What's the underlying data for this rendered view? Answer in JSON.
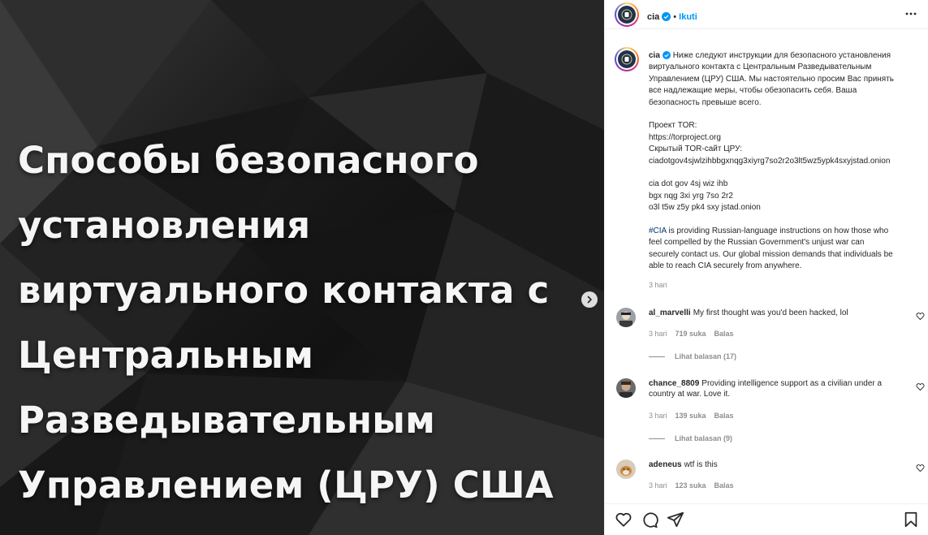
{
  "media": {
    "title_lines": [
      "Способы безопасного",
      "установления",
      "виртуального контакта с",
      "Центральным",
      "Разведывательным",
      "Управлением (ЦРУ) США"
    ]
  },
  "header": {
    "username": "cia",
    "separator": "•",
    "follow_label": "Ikuti"
  },
  "caption": {
    "username": "cia",
    "lines": [
      "Ниже следуют инструкции для безопасного установления",
      "виртуального контакта с Центральным Разведывательным",
      "Управлением (ЦРУ) США. Мы настоятельно просим Вас принять",
      "все надлежащие меры, чтобы обезопасить себя. Ваша",
      "безопасность превыше всего.",
      "",
      "Проект TOR:",
      "https://torproject.org",
      "Скрытый TOR-сайт ЦРУ:",
      "ciadotgov4sjwlzihbbgxnqg3xiyrg7so2r2o3lt5wz5ypk4sxyjstad.onion",
      "",
      "cia dot gov 4sj wiz ihb",
      "bgx nqg 3xi yrg 7so 2r2",
      "o3l t5w z5y pk4 sxy jstad.onion",
      ""
    ],
    "hashtag": "#CIA",
    "english_first": " is providing Russian-language instructions on how those who",
    "english_lines": [
      "feel compelled by the Russian Government's unjust war can",
      "securely contact us. Our global mission demands that individuals be",
      "able to reach CIA securely from anywhere."
    ],
    "time": "3 hari"
  },
  "comments": [
    {
      "username": "al_marvelli",
      "text": "My first thought was you'd been hacked, lol",
      "time": "3 hari",
      "likes": "719 suka",
      "reply": "Balas",
      "view_replies": "Lihat balasan (17)"
    },
    {
      "username": "chance_8809",
      "text": "Providing intelligence support as a civilian under a country at war. Love it.",
      "time": "3 hari",
      "likes": "139 suka",
      "reply": "Balas",
      "view_replies": "Lihat balasan (9)"
    },
    {
      "username": "adeneus",
      "text": "wtf is this",
      "time": "3 hari",
      "likes": "123 suka",
      "reply": "Balas"
    }
  ],
  "icons": {
    "like": "heart-icon",
    "comment": "comment-icon",
    "share": "share-icon",
    "save": "bookmark-icon",
    "more": "more-icon",
    "next": "chevron-right-icon"
  },
  "colors": {
    "accent": "#0095f6",
    "hashtag": "#00376b",
    "secondary_text": "#8e8e8e"
  }
}
